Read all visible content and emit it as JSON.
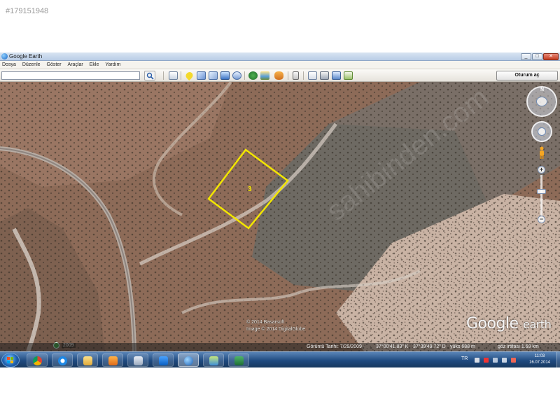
{
  "listing_id": "#179151948",
  "window": {
    "title": "Google Earth",
    "controls": {
      "minimize": "_",
      "maximize": "□",
      "close": "✕"
    }
  },
  "menu": [
    "Dosya",
    "Düzenle",
    "Göster",
    "Araçlar",
    "Ekle",
    "Yardım"
  ],
  "toolbar": {
    "search_value": "",
    "tour_button": "Oturum aç",
    "icons": [
      "sidebar-icon",
      "placemark-icon",
      "polygon-icon",
      "path-icon",
      "overlay-icon",
      "record-tour-icon",
      "historical-imagery-icon",
      "sunlight-icon",
      "sky-icon",
      "ruler-icon",
      "email-icon",
      "print-icon",
      "save-image-icon",
      "view-in-maps-icon"
    ]
  },
  "map": {
    "parcel_label": "3",
    "parcel_color": "#f2e600",
    "watermark": "sahibinden.com",
    "copyright_lines": [
      "© 2014 Basarsoft",
      "Image © 2014 DigitalGlobe"
    ],
    "logo_google": "Google",
    "logo_earth": "earth",
    "history_year": "2009",
    "nav_north": "N"
  },
  "status_bar": {
    "imagery_date": "Görüntü Tarihi: 7/29/2009",
    "latitude": "37°00'41.83\" K",
    "longitude": "37°39'49.72\" D",
    "elevation": "yüks 688 m",
    "eye_altitude": "göz irtifası 1.69 km"
  },
  "taskbar": {
    "apps": [
      "chrome-icon",
      "internet-explorer-icon",
      "explorer-folder-icon",
      "media-player-icon",
      "calculator-icon",
      "teamviewer-icon",
      "google-earth-icon",
      "paint-icon",
      "excel-icon"
    ],
    "language": "TR",
    "time": "11:03",
    "date": "16.07.2014"
  },
  "colors": {
    "taskbar": "#1f4a80",
    "terrain_brown": "#8d6b58",
    "terrain_gray": "#6e6a63"
  }
}
